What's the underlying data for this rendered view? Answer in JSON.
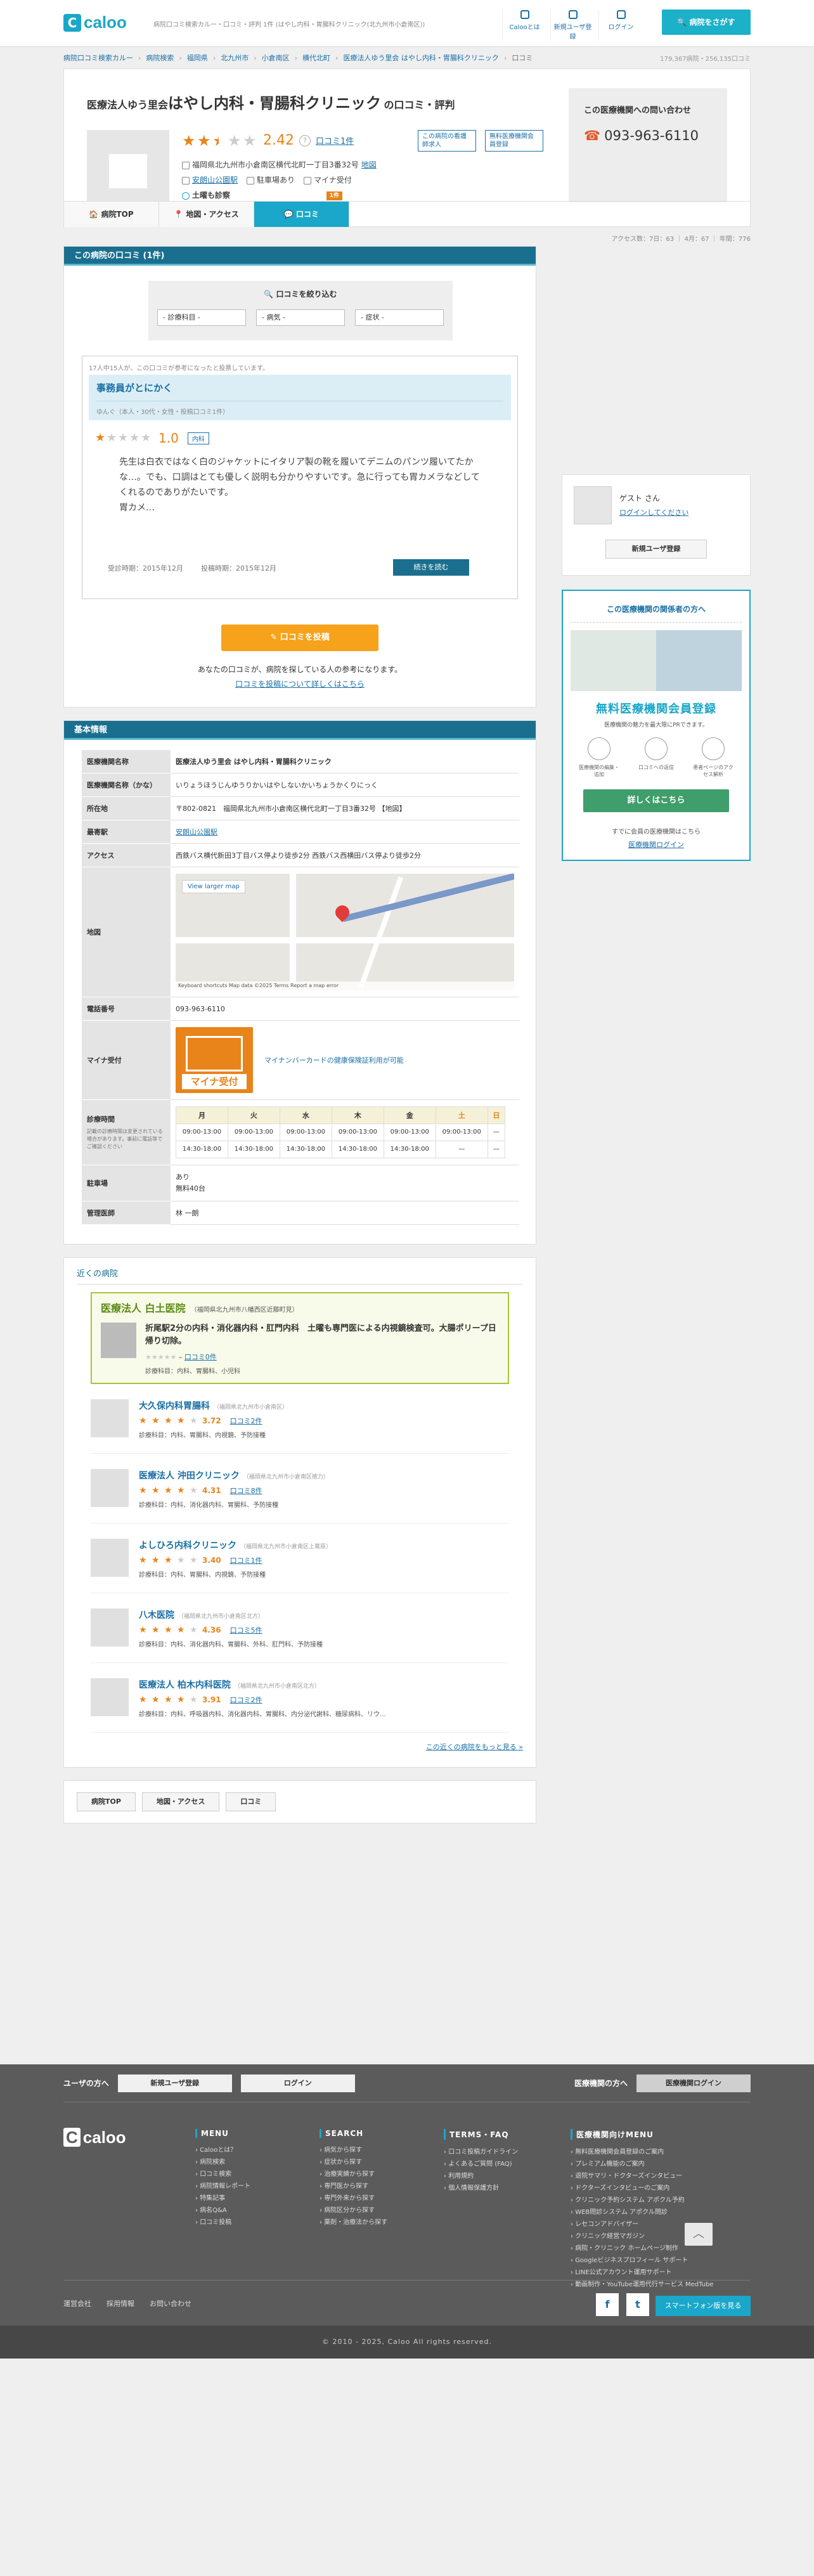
{
  "header": {
    "logo": "caloo",
    "tagline": "病院口コミ検索カルー・口コミ・評判 1件 (はやし内科・胃腸科クリニック(北九州市小倉南区))",
    "nav": [
      "Calooとは",
      "新規ユーザ登録",
      "ログイン"
    ],
    "search_btn": "病院をさがす"
  },
  "breadcrumb": [
    "病院口コミ検索カルー",
    "病院検索",
    "福岡県",
    "北九州市",
    "小倉南区",
    "横代北町",
    "医療法人ゆう里会 はやし内科・胃腸科クリニック",
    "口コミ"
  ],
  "stats": "179,367病院・256,135口コミ",
  "clinic": {
    "corp": "医療法人ゆう里会",
    "name": "はやし内科・胃腸科クリニック",
    "suffix": "の口コミ・評判",
    "rating": "2.42",
    "reviews_link": "口コミ1件",
    "address": "福岡県北九州市小倉南区横代北町一丁目3番32号",
    "map_link": "地図",
    "station": "安朗山公園駅",
    "parking": "駐車場あり",
    "mynum": "マイナ受付",
    "sat": "土曜も診察",
    "btn1": "この病院の看護師求人",
    "btn2": "無料医療機関会員登録"
  },
  "contact": {
    "title": "この医療機関への問い合わせ",
    "phone": "093-963-6110"
  },
  "tabs": {
    "top": "病院TOP",
    "access": "地図・アクセス",
    "reviews": "口コミ",
    "badge": "1件"
  },
  "subbar": "アクセス数：7日：63 ｜ 4月：67 ｜ 年間：776",
  "reviews": {
    "heading": "この病院の口コミ (1件)",
    "filter_title": "口コミを絞り込む",
    "sel1": "- 診療科目 -",
    "sel2": "- 病気 -",
    "sel3": "- 症状 -",
    "note": "17人中15人が、この口コミが参考になったと投票しています。",
    "title": "事務員がとにかく",
    "user": "ゆんぐ（本人・30代・女性・投稿口コミ1件）",
    "score": "1.0",
    "tag": "内科",
    "body": "先生は白衣ではなく白のジャケットにイタリア製の靴を履いてデニムのパンツ履いてたかな…。でも、口調はとても優しく説明も分かりやすいです。急に行っても胃カメラなどしてくれるのでありがたいです。\n胃カメ…",
    "visit": "受診時期：2015年12月",
    "post": "投稿時期：2015年12月",
    "more": "続きを読む",
    "post_btn": "口コミを投稿",
    "post_note": "あなたの口コミが、病院を探している人の参考になります。",
    "post_link": "口コミを投稿について詳しくはこちら"
  },
  "basic": {
    "heading": "基本情報",
    "rows": [
      {
        "k": "医療機関名称",
        "v": "医療法人ゆう里会 はやし内科・胃腸科クリニック"
      },
      {
        "k": "医療機関名称（かな）",
        "v": "いりょうほうじんゆうりかいはやしないかいちょうかくりにっく"
      },
      {
        "k": "所在地",
        "v": "〒802-0821　福岡県北九州市小倉南区横代北町一丁目3番32号 【地図】"
      },
      {
        "k": "最寄駅",
        "v": "安朗山公園駅"
      },
      {
        "k": "アクセス",
        "v": "西鉄バス横代新田3丁目バス停より徒歩2分 西鉄バス西横田バス停より徒歩2分"
      }
    ],
    "map_label": "地図",
    "map_view": "View larger map",
    "map_foot": "Keyboard shortcuts  Map data ©2025  Terms  Report a map error",
    "tel_k": "電話番号",
    "tel_v": "093-963-6110",
    "mn_k": "マイナ受付",
    "mn_card": "マイナ受付",
    "mn_v": "マイナンバーカードの健康保険証利用が可能",
    "hr_k": "診療時間",
    "hr_note": "記載の診療時間は変更されている場合があります。事前に電話等でご確認ください",
    "days": [
      "月",
      "火",
      "水",
      "木",
      "金",
      "土",
      "日"
    ],
    "am": [
      "09:00-13:00",
      "09:00-13:00",
      "09:00-13:00",
      "09:00-13:00",
      "09:00-13:00",
      "09:00-13:00",
      "—"
    ],
    "pm": [
      "14:30-18:00",
      "14:30-18:00",
      "14:30-18:00",
      "14:30-18:00",
      "14:30-18:00",
      "—",
      "—"
    ],
    "pk_k": "駐車場",
    "pk_v": "あり\n無料40台",
    "dr_k": "管理医師",
    "dr_v": "林 一朗"
  },
  "nearby": {
    "heading": "近くの病院",
    "feat_name": "医療法人 白土医院",
    "feat_loc": "（福岡県北九州市八幡西区近藤町見）",
    "feat_txt": "折尾駅2分の内科・消化器内科・肛門内科　土曜も専門医による内視鏡検査可。大腸ポリープ日帰り切除。",
    "feat_link": "口コミ0件",
    "feat_dept": "診療科目：内科、胃腸科、小児科",
    "items": [
      {
        "name": "大久保内科胃腸科",
        "loc": "（福岡県北九州市小倉南区）",
        "rating": "3.72",
        "link": "口コミ2件",
        "dept": "診療科目：内科、胃腸科、内視鏡、予防接種",
        "stars": 4
      },
      {
        "name": "医療法人 沖田クリニック",
        "loc": "（福岡県北九州市小倉南区徳力）",
        "rating": "4.31",
        "link": "口コミ8件",
        "dept": "診療科目：内科、消化器内科、胃腸科、予防接種",
        "stars": 4
      },
      {
        "name": "よしひろ内科クリニック",
        "loc": "（福岡県北九州市小倉南区上葛原）",
        "rating": "3.40",
        "link": "口コミ1件",
        "dept": "診療科目：内科、胃腸科、内視鏡、予防接種",
        "stars": 3
      },
      {
        "name": "八木医院",
        "loc": "（福岡県北九州市小倉南区北方）",
        "rating": "4.36",
        "link": "口コミ5件",
        "dept": "診療科目：内科、消化器内科、胃腸科、外科、肛門科、予防接種",
        "stars": 4
      },
      {
        "name": "医療法人 柏木内科医院",
        "loc": "（福岡県北九州市小倉南区北方）",
        "rating": "3.91",
        "link": "口コミ2件",
        "dept": "診療科目：内科、呼吸器内科、消化器内科、胃腸科、内分泌代謝科、糖尿病科、リウ…",
        "stars": 4
      }
    ],
    "more": "この近くの病院をもっと見る »"
  },
  "side": {
    "guest": "ゲスト",
    "san": "さん",
    "login": "ログインしてください",
    "reg": "新規ユーザ登録",
    "med_title": "この医療機関の関係者の方へ",
    "reg_title": "無料医療機関会員登録",
    "reg_sm": "医療機関の魅力を最大限にPRできます。",
    "ics": [
      "医療機関の編集・追加",
      "口コミへの返信",
      "患者ページのアクセス解析"
    ],
    "reg_btn": "詳しくはこちら",
    "note": "すでに会員の医療機関はこちら",
    "link": "医療機関ログイン"
  },
  "footer": {
    "user": "ユーザの方へ",
    "reg": "新規ユーザ登録",
    "login": "ログイン",
    "med": "医療機関の方へ",
    "medlogin": "医療機関ログイン",
    "logo": "caloo",
    "cols": [
      {
        "h": "MENU",
        "items": [
          "Calooとは？",
          "病院検索",
          "口コミ検索",
          "病院情報レポート",
          "特集記事",
          "病名Q&A",
          "口コミ投稿"
        ]
      },
      {
        "h": "SEARCH",
        "items": [
          "病気から探す",
          "症状から探す",
          "治療実績から探す",
          "専門医から探す",
          "専門外来から探す",
          "病院区分から探す",
          "薬剤・治療法から探す"
        ]
      },
      {
        "h": "TERMS・FAQ",
        "items": [
          "口コミ投稿ガイドライン",
          "よくあるご質問 (FAQ)",
          "利用規約",
          "個人情報保護方針"
        ]
      },
      {
        "h": "医療機関向けMENU",
        "items": [
          "無料医療機関会員登録のご案内",
          "プレミアム機能のご案内",
          "退院サマリ・ドクターズインタビュー",
          "ドクターズインタビューのご案内",
          "クリニック予約システム アポクル予約",
          "WEB問診システム アポクル問診",
          "レセコンアドバイザー",
          "クリニック経営マガジン",
          "病院・クリニック ホームページ制作",
          "Googleビジネスプロフィール サポート",
          "LINE公式アカウント運用サポート",
          "動画制作・YouTube運用代行サービス MedTube"
        ]
      }
    ],
    "links": [
      "運営会社",
      "採用情報",
      "お問い合わせ"
    ],
    "sp": "スマートフォン版を見る",
    "copy": "© 2010 - 2025, Caloo All rights reserved."
  }
}
